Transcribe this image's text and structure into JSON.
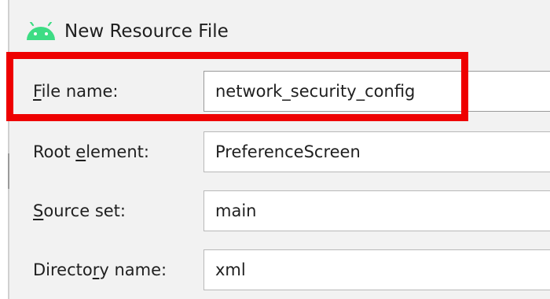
{
  "window": {
    "title": "New Resource File",
    "icon": "android-icon",
    "icon_color": "#3ddc84"
  },
  "form": {
    "file_name": {
      "label_mnemonic": "F",
      "label_rest": "ile name:",
      "value": "network_security_config"
    },
    "root_element": {
      "label_before": "Root ",
      "label_mnemonic": "e",
      "label_rest": "lement:",
      "value": "PreferenceScreen"
    },
    "source_set": {
      "label_mnemonic": "S",
      "label_rest": "ource set:",
      "value": "main"
    },
    "directory_name": {
      "label_before": "Directo",
      "label_mnemonic": "r",
      "label_rest": "y name:",
      "value": "xml"
    }
  },
  "annotation": {
    "highlight_color": "#ee0000"
  }
}
